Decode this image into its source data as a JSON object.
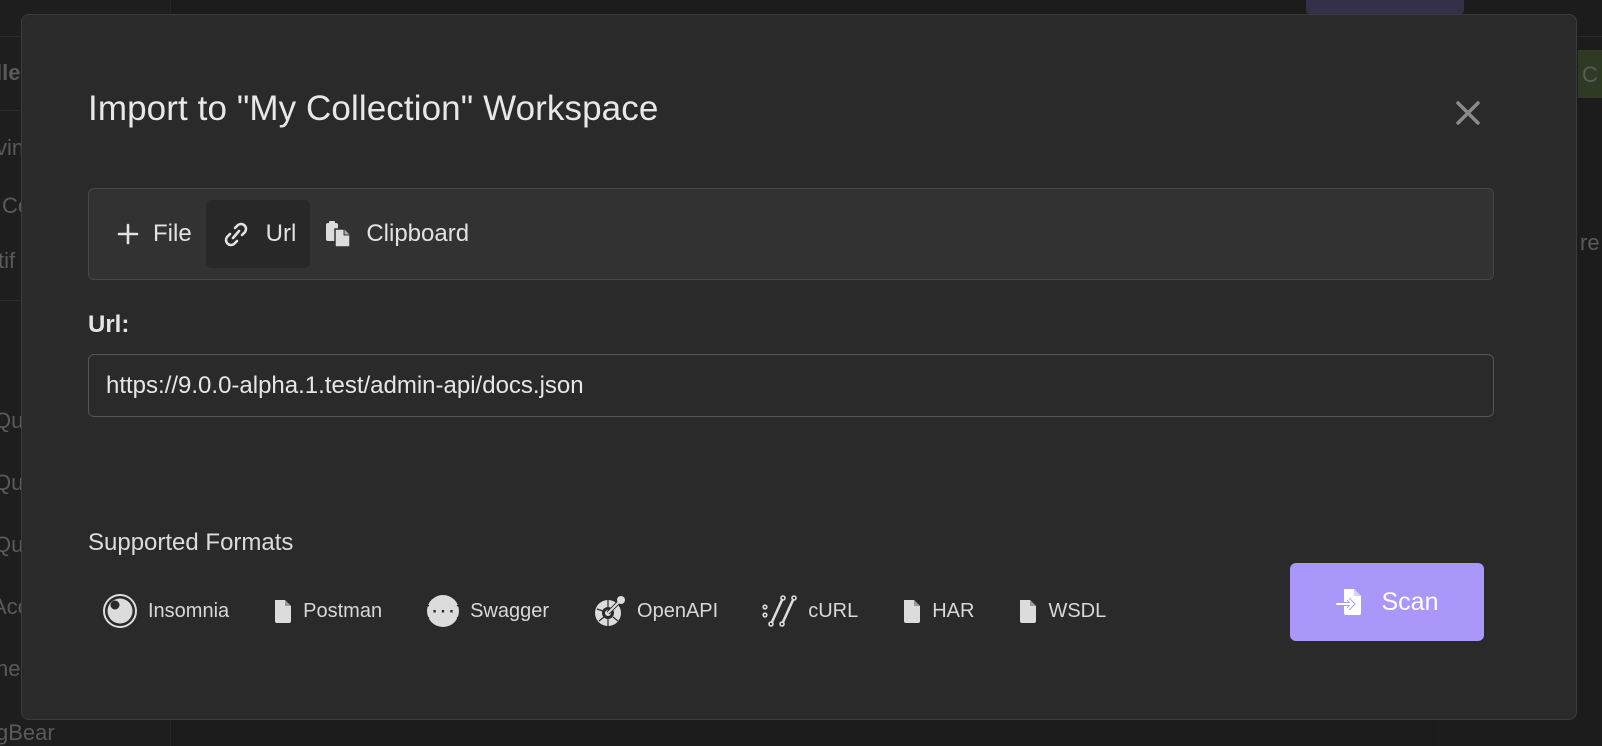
{
  "background": {
    "left_fragments": [
      "lle",
      "vin",
      "Co",
      "tif",
      "Qu",
      "Qu",
      "Qu",
      "Acc",
      "he",
      "gBear"
    ],
    "right_fragments": [
      "C",
      "re"
    ]
  },
  "modal": {
    "title": "Import to \"My Collection\" Workspace",
    "close_icon": "close-icon",
    "tabs": [
      {
        "label": "File",
        "icon": "plus-icon",
        "active": false
      },
      {
        "label": "Url",
        "icon": "link-icon",
        "active": true
      },
      {
        "label": "Clipboard",
        "icon": "clipboard-icon",
        "active": false
      }
    ],
    "url_label": "Url:",
    "url_value": "https://9.0.0-alpha.1.test/admin-api/docs.json",
    "supported_title": "Supported Formats",
    "formats": [
      {
        "label": "Insomnia",
        "icon": "insomnia-icon"
      },
      {
        "label": "Postman",
        "icon": "file-icon"
      },
      {
        "label": "Swagger",
        "icon": "swagger-icon"
      },
      {
        "label": "OpenAPI",
        "icon": "openapi-icon"
      },
      {
        "label": "cURL",
        "icon": "curl-icon"
      },
      {
        "label": "HAR",
        "icon": "file-icon"
      },
      {
        "label": "WSDL",
        "icon": "file-icon"
      }
    ],
    "scan_label": "Scan",
    "accent_color": "#aa97f9"
  }
}
